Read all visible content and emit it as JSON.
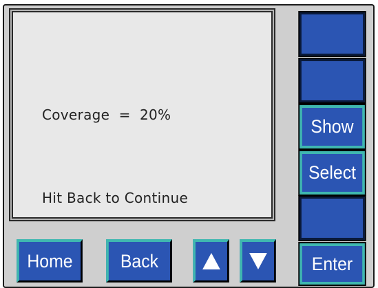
{
  "screen": {
    "coverage_label": "Coverage",
    "coverage_operator": "=",
    "coverage_value": "20%",
    "hint": "Hit Back to Continue"
  },
  "side_buttons": [
    {
      "label": ""
    },
    {
      "label": ""
    },
    {
      "label": "Show"
    },
    {
      "label": "Select"
    },
    {
      "label": ""
    },
    {
      "label": "Enter"
    }
  ],
  "bottom_buttons": {
    "home": "Home",
    "back": "Back",
    "up_icon": "up-arrow-icon",
    "down_icon": "down-arrow-icon"
  },
  "colors": {
    "button_blue": "#2b55b3",
    "bevel_teal": "#3fb7b0",
    "panel_gray": "#cfcfcf",
    "screen_bg": "#e8e8e8"
  }
}
